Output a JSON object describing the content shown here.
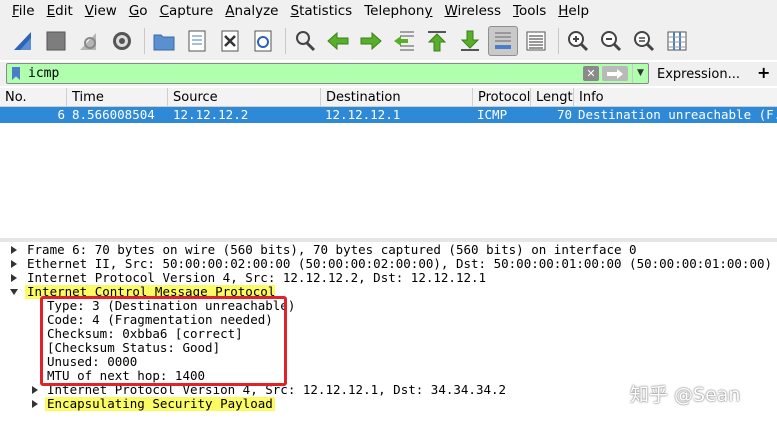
{
  "menu": [
    "File",
    "Edit",
    "View",
    "Go",
    "Capture",
    "Analyze",
    "Statistics",
    "Telephony",
    "Wireless",
    "Tools",
    "Help"
  ],
  "menu_access_keys": [
    "F",
    "E",
    "V",
    "G",
    "C",
    "A",
    "S",
    "y",
    "W",
    "T",
    "H"
  ],
  "toolbar_icons": [
    "shark-fin-start-icon",
    "stop-square-icon",
    "restart-shark-icon",
    "options-gear-icon",
    "open-folder-icon",
    "save-file-icon",
    "close-file-icon",
    "reload-file-icon",
    "find-magnifier-icon",
    "go-back-arrow-icon",
    "go-forward-arrow-icon",
    "go-to-packet-icon",
    "go-first-icon",
    "go-last-icon",
    "autoscroll-icon",
    "colorize-icon",
    "zoom-in-icon",
    "zoom-out-icon",
    "zoom-normal-icon",
    "resize-columns-icon"
  ],
  "filter": {
    "value": "icmp",
    "valid_color": "#afffaf",
    "expression_label": "Expression...",
    "add_label": "+"
  },
  "packet_list": {
    "columns": [
      "No.",
      "Time",
      "Source",
      "Destination",
      "Protocol",
      "Length",
      "Info"
    ],
    "rows": [
      {
        "no": "6",
        "time": "8.566008504",
        "source": "12.12.12.2",
        "destination": "12.12.12.1",
        "protocol": "ICMP",
        "length": "70",
        "info": "Destination unreachable (F..."
      }
    ],
    "selected_color": "#2e8ad6"
  },
  "details": {
    "frame": "Frame 6: 70 bytes on wire (560 bits), 70 bytes captured (560 bits) on interface 0",
    "ethernet": "Ethernet II, Src: 50:00:00:02:00:00 (50:00:00:02:00:00), Dst: 50:00:00:01:00:00 (50:00:00:01:00:00)",
    "ipv4": "Internet Protocol Version 4, Src: 12.12.12.2, Dst: 12.12.12.1",
    "icmp": "Internet Control Message Protocol",
    "icmp_fields": [
      "Type: 3 (Destination unreachable)",
      "Code: 4 (Fragmentation needed)",
      "Checksum: 0xbba6 [correct]",
      "[Checksum Status: Good]",
      "Unused: 0000",
      "MTU of next hop: 1400"
    ],
    "inner_ipv4": "Internet Protocol Version 4, Src: 12.12.12.1, Dst: 34.34.34.2",
    "esp": "Encapsulating Security Payload",
    "highlight_color": "#fbfb63",
    "annotation_color": "#e02329"
  },
  "watermark": "知乎 @Sean"
}
